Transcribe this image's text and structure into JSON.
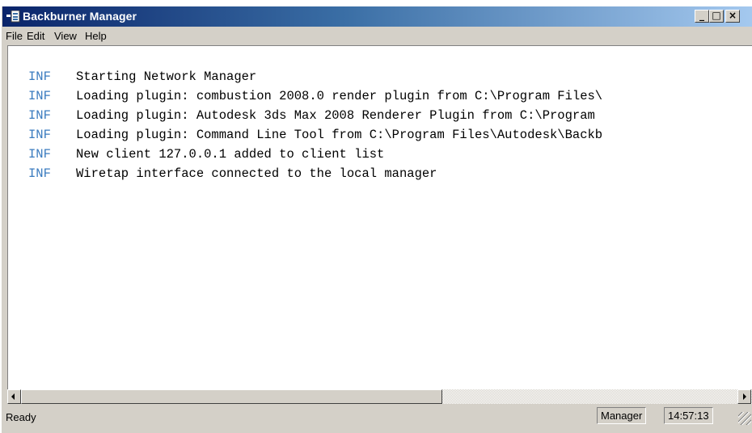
{
  "window": {
    "title": "Backburner Manager",
    "controls": {
      "minimize": "_",
      "maximize": "□",
      "close": "×"
    }
  },
  "menu": [
    "File",
    "Edit",
    "View",
    "Help"
  ],
  "log": [
    {
      "level": "INF",
      "message": "Starting Network Manager"
    },
    {
      "level": "INF",
      "message": "Loading plugin: combustion 2008.0 render plugin from C:\\Program Files\\"
    },
    {
      "level": "INF",
      "message": "Loading plugin: Autodesk 3ds Max 2008 Renderer Plugin from C:\\Program"
    },
    {
      "level": "INF",
      "message": "Loading plugin: Command Line Tool from C:\\Program Files\\Autodesk\\Backb"
    },
    {
      "level": "INF",
      "message": "New client 127.0.0.1 added to client list"
    },
    {
      "level": "INF",
      "message": "Wiretap interface connected to the local manager"
    }
  ],
  "status": {
    "text": "Ready",
    "mode": "Manager",
    "time": "14:57:13"
  },
  "icons": [
    "app-icon",
    "scroll-left-icon",
    "scroll-right-icon",
    "resize-grip-icon"
  ],
  "colors": {
    "title_start": "#0a246a",
    "title_end": "#a6caf0",
    "log_level": "#3a7bbf",
    "chrome": "#d4d0c8"
  }
}
